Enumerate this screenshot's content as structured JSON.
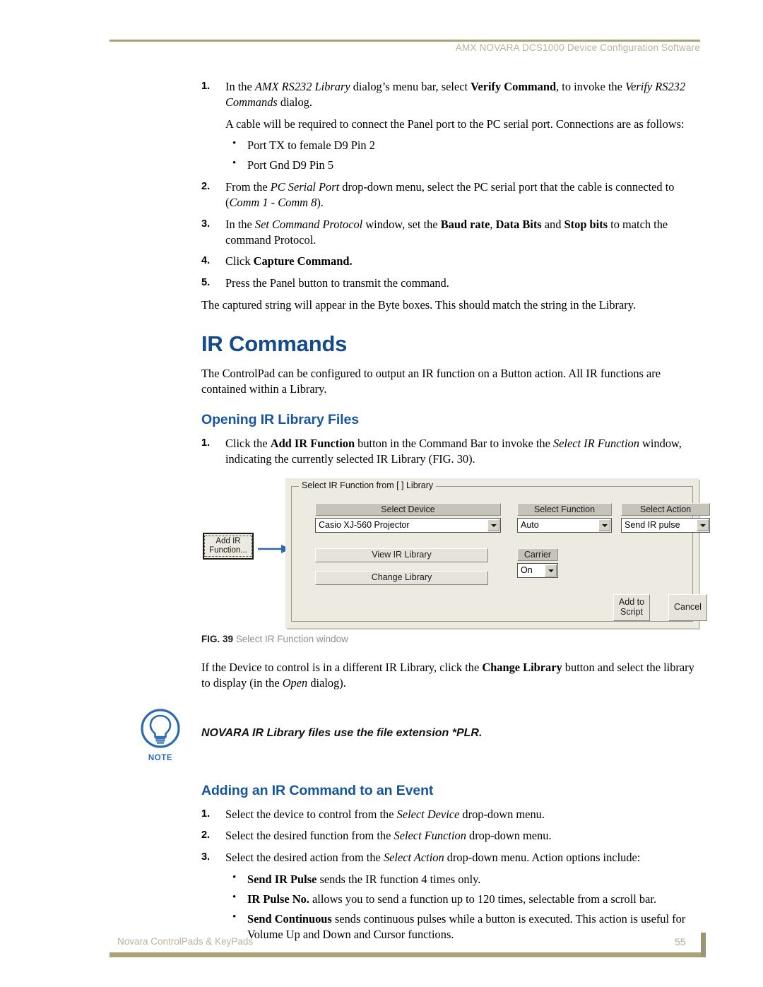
{
  "header": {
    "title": "AMX NOVARA DCS1000 Device Configuration Software"
  },
  "footer": {
    "left": "Novara ControlPads  & KeyPads",
    "page": "55"
  },
  "colors": {
    "rule": "#a9a478",
    "header_text": "#b9b49b",
    "heading_blue": "#134a8e",
    "subheading_blue": "#17549c",
    "note_blue": "#2a6bb0",
    "arrow_blue": "#2a6bb0",
    "dialog_bg": "#edeae1"
  },
  "top_steps": [
    {
      "num": "1.",
      "html": "In the <i>AMX RS232 Library</i> dialog’s menu bar, select <b>Verify Command</b>, to invoke the <i>Verify RS232 Commands</i> dialog."
    }
  ],
  "cable_para": "A cable will be required to connect the Panel port to the PC serial port. Connections are as follows:",
  "cable_bullets": [
    "Port TX to female D9 Pin 2",
    "Port Gnd D9 Pin 5"
  ],
  "steps_2_5": [
    {
      "num": "2.",
      "html": "From the <i>PC Serial Port</i> drop-down menu, select the PC serial port that the cable is connected to (<i>Comm 1 - Comm 8</i>)."
    },
    {
      "num": "3.",
      "html": "In the <i>Set Command Protocol</i> window, set the <b>Baud rate</b>, <b>Data Bits</b> and <b>Stop bits</b> to match the command Protocol."
    },
    {
      "num": "4.",
      "html": "Click <b>Capture Command.</b>"
    },
    {
      "num": "5.",
      "html": "Press the Panel button to transmit the command."
    }
  ],
  "captured_para": "The captured string will appear in the Byte boxes. This should match the string in the Library.",
  "ir_commands": {
    "heading": "IR Commands",
    "intro": "The ControlPad can be configured to output an IR function on a Button action. All IR functions are contained within a Library."
  },
  "opening_section": {
    "heading": "Opening IR Library Files",
    "steps": [
      {
        "num": "1.",
        "html": "Click the <b>Add IR Function</b> button in the Command Bar to invoke the <i>Select IR Function</i> window, indicating the currently selected IR Library (FIG. 30)."
      }
    ]
  },
  "figure": {
    "caption_num": "FIG. 39",
    "caption_text": "Select IR Function window",
    "add_ir_button": {
      "line1": "Add IR",
      "line2": "Function..."
    },
    "dialog": {
      "group_title": "Select IR Function from [  ] Library",
      "select_device_label": "Select Device",
      "select_device_value": "Casio XJ-560  Projector",
      "select_function_label": "Select Function",
      "select_function_value": "Auto",
      "select_action_label": "Select Action",
      "select_action_value": "Send  IR pulse",
      "view_ir_library_button": "View IR Library",
      "change_library_button": "Change Library",
      "carrier_label": "Carrier",
      "carrier_value": "On",
      "add_to_script_line1": "Add to",
      "add_to_script_line2": "Script",
      "cancel_button": "Cancel"
    }
  },
  "after_figure_para": "If the Device to control is in a different IR Library, click the <b>Change Library</b> button and select the library to display (in the <i>Open</i> dialog).",
  "note": {
    "label": "NOTE",
    "text": "NOVARA IR Library files use the file extension *PLR."
  },
  "adding_section": {
    "heading": "Adding an IR Command to an Event",
    "steps": [
      {
        "num": "1.",
        "html": "Select the device to control from the <i>Select Device</i> drop-down menu."
      },
      {
        "num": "2.",
        "html": "Select the desired function from the <i>Select Function</i> drop-down menu."
      },
      {
        "num": "3.",
        "html": "Select the desired action from the <i>Select Action</i> drop-down menu. Action options include:"
      }
    ],
    "bullets": [
      "<b>Send IR Pulse</b> sends the IR function 4 times only.",
      "<b>IR Pulse No.</b> allows you to send a function up to 120 times, selectable from a scroll bar.",
      "<b>Send Continuous</b> sends continuous pulses while a button is executed. This action is useful for Volume Up and Down and Cursor functions."
    ]
  }
}
